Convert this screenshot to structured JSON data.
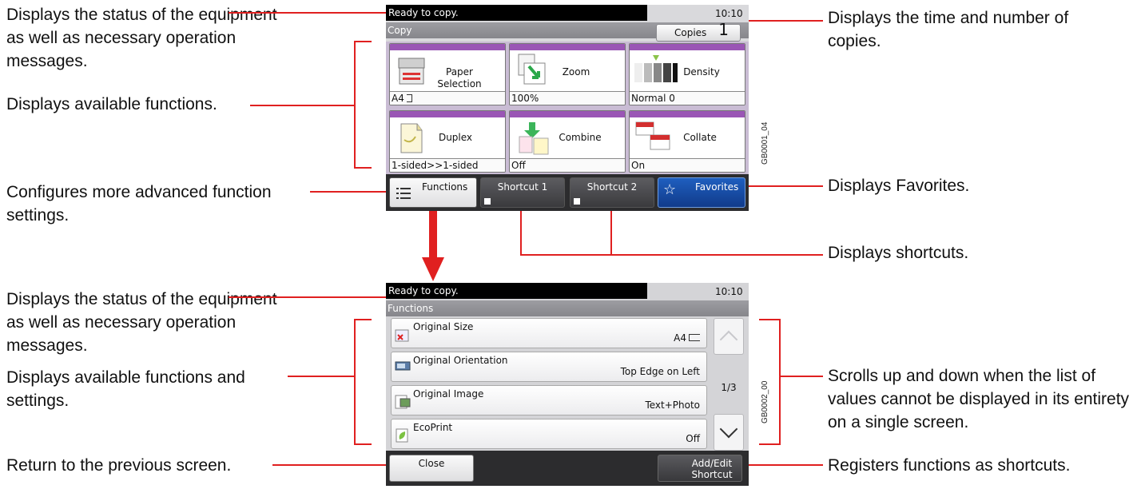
{
  "callouts": {
    "status1": "Displays the status of the equipment as well as necessary operation messages.",
    "functions_avail": "Displays available functions.",
    "advanced": "Configures more advanced function settings.",
    "time_copies": "Displays the time and number of copies.",
    "favorites": "Displays Favorites.",
    "shortcuts": "Displays shortcuts.",
    "status2": "Displays the status of the equipment as well as necessary operation messages.",
    "functions_settings": "Displays available functions and settings.",
    "return": "Return to the previous screen.",
    "scroll": "Scrolls up and down when the list of values cannot be displayed in its entirety on a single screen.",
    "register": "Registers functions as shortcuts."
  },
  "figure_ids": {
    "top": "GB0001_04",
    "bottom": "GB0002_00"
  },
  "copy_screen": {
    "status": "Ready to copy.",
    "time": "10:10",
    "title": "Copy",
    "copies_label": "Copies",
    "copies_value": "1",
    "tiles": [
      {
        "label": "Paper Selection",
        "value": "A4"
      },
      {
        "label": "Zoom",
        "value": "100%"
      },
      {
        "label": "Density",
        "value": "Normal 0"
      },
      {
        "label": "Duplex",
        "value": "1-sided>>1-sided"
      },
      {
        "label": "Combine",
        "value": "Off"
      },
      {
        "label": "Collate",
        "value": "On"
      }
    ],
    "tabs": {
      "functions": "Functions",
      "shortcut1": "Shortcut 1",
      "shortcut2": "Shortcut 2",
      "favorites": "Favorites"
    }
  },
  "functions_screen": {
    "status": "Ready to copy.",
    "time": "10:10",
    "title": "Functions",
    "rows": [
      {
        "label": "Original Size",
        "value": "A4"
      },
      {
        "label": "Original Orientation",
        "value": "Top Edge on Left"
      },
      {
        "label": "Original Image",
        "value": "Text+Photo"
      },
      {
        "label": "EcoPrint",
        "value": "Off"
      }
    ],
    "page": "1/3",
    "close": "Close",
    "add_edit": "Add/Edit Shortcut"
  },
  "colors": {
    "accent_red": "#e02020",
    "tile_purple": "#9a56b5",
    "favorites_blue": "#1a4fa8"
  }
}
